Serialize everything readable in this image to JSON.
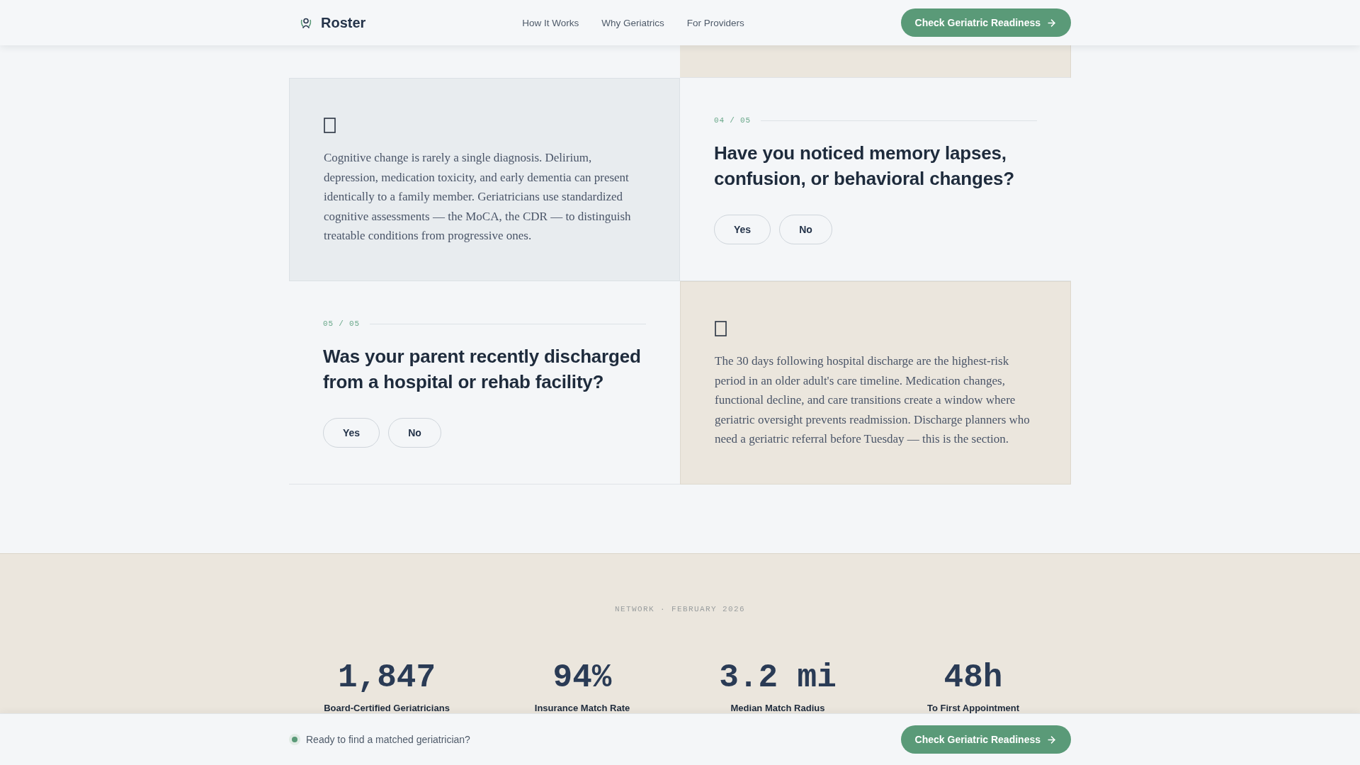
{
  "header": {
    "brand": "Roster",
    "nav": [
      {
        "label": "How It Works"
      },
      {
        "label": "Why Geriatrics"
      },
      {
        "label": "For Providers"
      }
    ],
    "cta": "Check Geriatric Readiness"
  },
  "rows": [
    {
      "cells": [
        {
          "kind": "note",
          "text": "Cognitive change is rarely a single diagnosis. Delirium, depression, medication toxicity, and early dementia can present identically to a family member. Geriatricians use standardized cognitive assessments — the MoCA, the CDR — to distinguish treatable conditions from progressive ones."
        },
        {
          "kind": "question",
          "step": "04 / 05",
          "question": "Have you noticed memory lapses, confusion, or behavioral changes?",
          "answers": [
            {
              "label": "Yes",
              "selected": false
            },
            {
              "label": "No",
              "selected": false
            }
          ]
        }
      ]
    },
    {
      "cells": [
        {
          "kind": "question",
          "step": "05 / 05",
          "question": "Was your parent recently discharged from a hospital or rehab facility?",
          "answers": [
            {
              "label": "Yes",
              "selected": false
            },
            {
              "label": "No",
              "selected": false
            }
          ]
        },
        {
          "kind": "note",
          "text": "The 30 days following hospital discharge are the highest-risk period in an older adult's care timeline. Medication changes, functional decline, and care transitions create a window where geriatric oversight prevents readmission. Discharge planners who need a geriatric referral before Tuesday — this is the section."
        }
      ]
    }
  ],
  "network": {
    "kicker": "NETWORK · FEBRUARY 2026",
    "stats": [
      {
        "value": "1,847",
        "label": "Board-Certified Geriatricians"
      },
      {
        "value": "94%",
        "label": "Insurance Match Rate"
      },
      {
        "value": "3.2 mi",
        "label": "Median Match Radius"
      },
      {
        "value": "48h",
        "label": "To First Appointment"
      }
    ]
  },
  "bottom_bar": {
    "prompt": "Ready to find a matched geriatrician?",
    "cta": "Check Geriatric Readiness"
  }
}
